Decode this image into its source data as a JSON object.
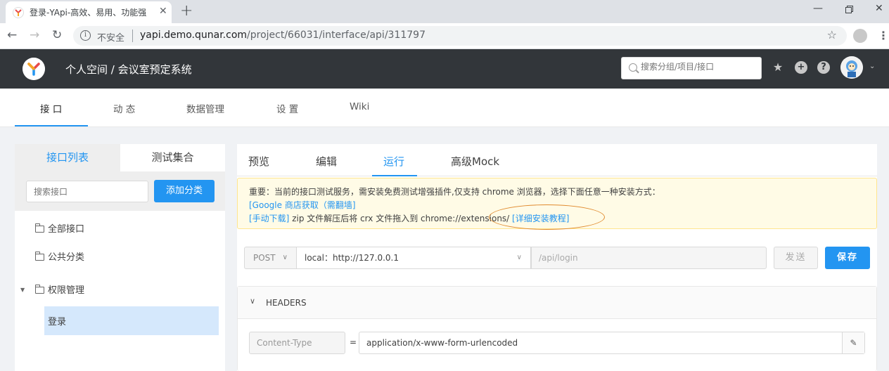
{
  "browser": {
    "tab_title": "登录-YApi-高效、易用、功能强",
    "close_glyph": "✕",
    "newtab_glyph": "+",
    "insecure_label": "不安全",
    "url_host": "yapi.demo.qunar.com",
    "url_path": "/project/66031/interface/api/311797"
  },
  "header": {
    "breadcrumb": "个人空间 / 会议室预定系统",
    "search_placeholder": "搜索分组/项目/接口"
  },
  "subnav": {
    "items": [
      "接 口",
      "动 态",
      "数据管理",
      "设 置",
      "Wiki"
    ]
  },
  "left": {
    "tab_active": "接口列表",
    "tab_inactive": "测试集合",
    "search_placeholder": "搜索接口",
    "add_button": "添加分类",
    "tree": [
      "全部接口",
      "公共分类",
      "权限管理"
    ],
    "selected_leaf": "登录"
  },
  "right": {
    "tabs": [
      "预览",
      "编辑",
      "运行",
      "高级Mock"
    ],
    "notice_line1": "重要：当前的接口测试服务，需安装免费测试增强插件,仅支持 chrome 浏览器，选择下面任意一种安装方式：",
    "notice_link_google": "[Google 商店获取（需翻墙]",
    "notice_link_manual": "[手动下载]",
    "notice_line3_text": " zip 文件解压后将 crx 文件拖入到 chrome://extensions/ ",
    "notice_link_tutorial": "[详细安装教程]",
    "method": "POST",
    "host": "local：http://127.0.0.1",
    "path": "/api/login",
    "send_label": "发送",
    "save_label": "保存",
    "headers_title": "HEADERS",
    "header_key": "Content-Type",
    "header_eq": "=",
    "header_value": "application/x-www-form-urlencoded"
  },
  "colors": {
    "accent": "#2395f1",
    "header_bg": "#32363a",
    "notice_bg": "#fffbe6",
    "highlight_ellipse": "#e08a2e"
  }
}
